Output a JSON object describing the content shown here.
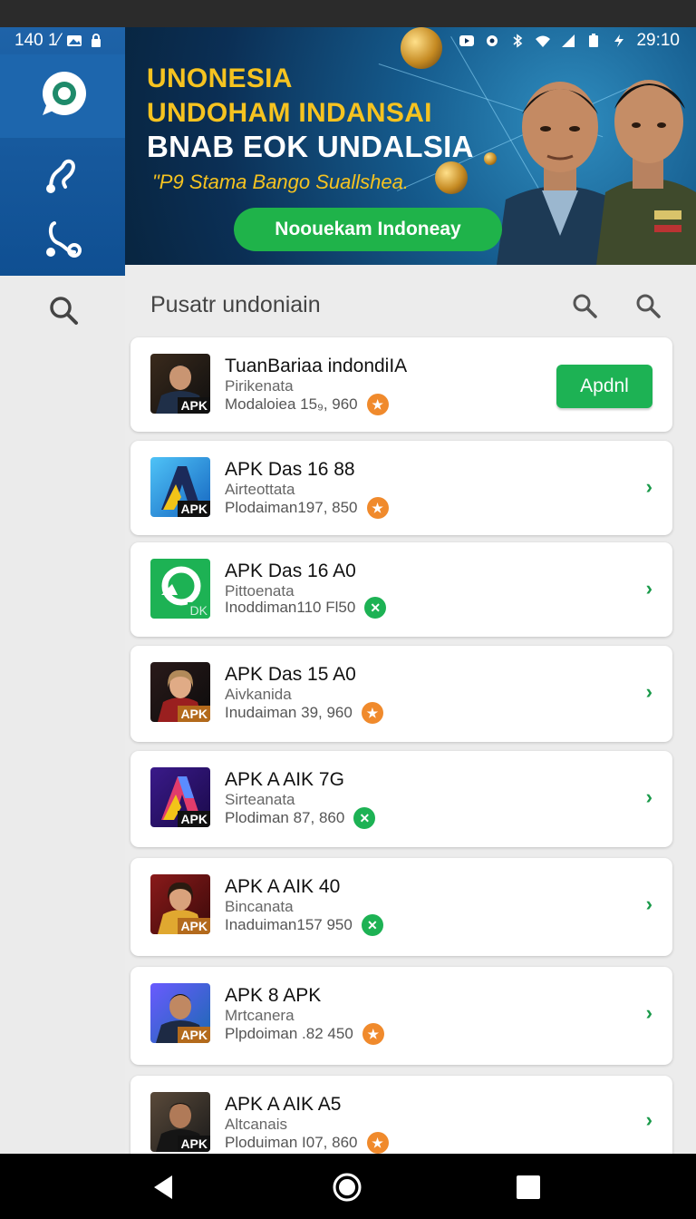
{
  "status_bar": {
    "time_left": "140 1⁄",
    "time_right": "29:10"
  },
  "banner": {
    "line1": "UNONESIA",
    "line2": "UNDOHAM INDANSAI",
    "line3": "BNAB EOK UNDALSIA",
    "subtitle": "\"P9 Stama Bango Suallshea.",
    "cta_label": "Nooueka​m Indoneay"
  },
  "main": {
    "title": "Pusatr undoniain"
  },
  "items": [
    {
      "title": "TuanBariaa indondiIA",
      "sub": "Pirikenata",
      "meta": "Modaloiea 15₉, 960",
      "badge": "orange",
      "action": "Apdnl",
      "tag": "APK",
      "tag_style": "dark",
      "thumb": "person"
    },
    {
      "title": "APK Das 16 88",
      "sub": "Airteottata",
      "meta": "Plodaiman197, 850",
      "badge": "orange",
      "tag": "APK",
      "tag_style": "dark",
      "thumb": "letterA"
    },
    {
      "title": "APK Das 16 A0",
      "sub": "Pittoenata",
      "meta": "Inoddiman110 Fl50",
      "badge": "green",
      "tag": "DK",
      "tag_style": "green",
      "thumb": "green"
    },
    {
      "title": "APK Das 15 A0",
      "sub": "Aivkanida",
      "meta": "Inudaiman  39, 960",
      "badge": "orange",
      "tag": "APK",
      "tag_style": "orange",
      "thumb": "woman"
    },
    {
      "title": "APK A AIK 7G",
      "sub": "Sirteanata",
      "meta": "Plodiman  87, 860",
      "badge": "green",
      "tag": "APK",
      "tag_style": "dark",
      "thumb": "letterA2"
    },
    {
      "title": "APK A AIK 40",
      "sub": "Bincanata",
      "meta": "Inaduiman157 950",
      "badge": "green",
      "tag": "APK",
      "tag_style": "orange",
      "thumb": "woman2"
    },
    {
      "title": "APK 8 APK",
      "sub": "Mrtcanera",
      "meta": "Plpdoiman .82 450",
      "badge": "orange",
      "tag": "APK",
      "tag_style": "orange",
      "thumb": "person2"
    },
    {
      "title": "APK A AIK A5",
      "sub": "Altcanais",
      "meta": "Ploduiman I07, 860",
      "badge": "orange",
      "tag": "APK",
      "tag_style": "dark",
      "thumb": "person3"
    }
  ],
  "icons": {
    "chevron": "›",
    "badge_orange": "★",
    "badge_green": "✕"
  }
}
